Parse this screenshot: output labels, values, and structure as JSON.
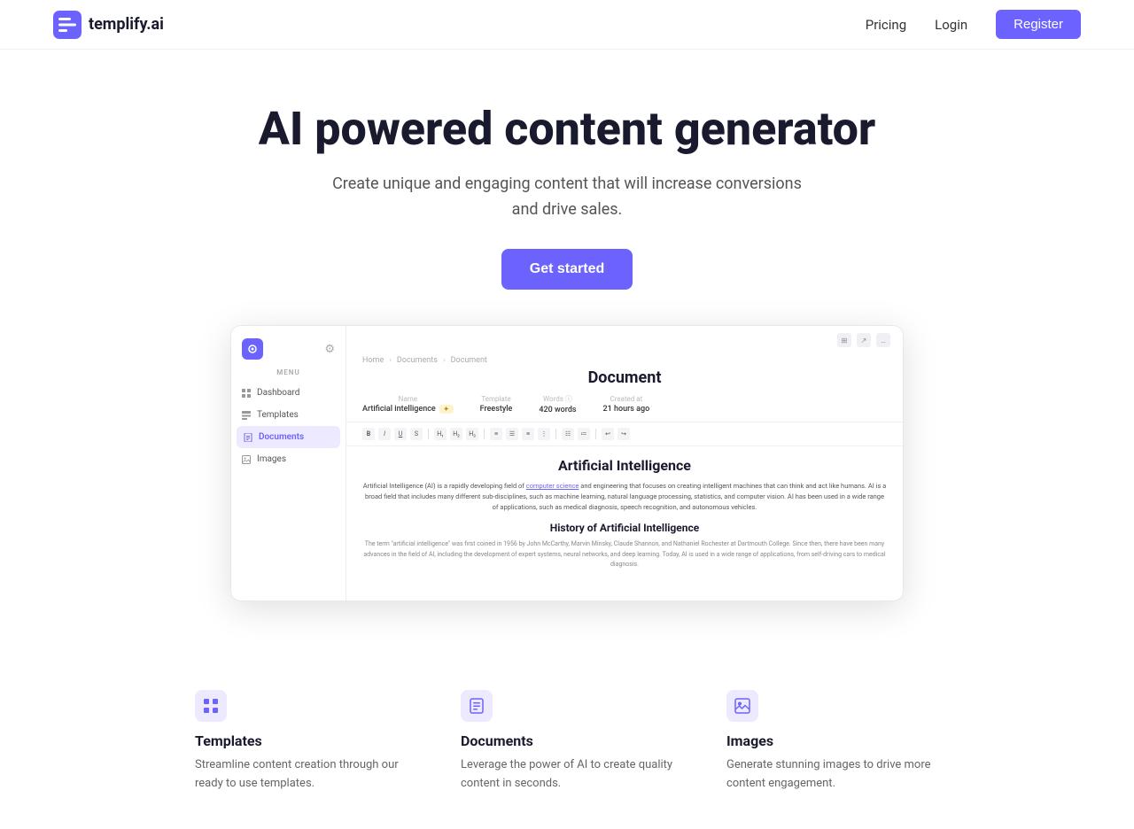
{
  "nav": {
    "logo_text": "templify.ai",
    "links": [
      {
        "label": "Pricing",
        "id": "pricing"
      },
      {
        "label": "Login",
        "id": "login"
      }
    ],
    "register_label": "Register"
  },
  "hero": {
    "title": "AI powered content generator",
    "subtitle": "Create unique and engaging content that will increase conversions and drive sales.",
    "cta_label": "Get started"
  },
  "app_screenshot": {
    "breadcrumbs": [
      "Home",
      "Documents",
      "Document"
    ],
    "doc_title": "Document",
    "meta": [
      {
        "label": "Name",
        "value": "Artificial intelligence",
        "tag": ""
      },
      {
        "label": "Template",
        "value": "Freestyle",
        "tag": "tag"
      },
      {
        "label": "Words",
        "value": "420 words"
      },
      {
        "label": "Created at",
        "value": "21 hours ago"
      }
    ],
    "sidebar": {
      "menu_label": "MENU",
      "items": [
        {
          "label": "Dashboard",
          "id": "dashboard",
          "active": false
        },
        {
          "label": "Templates",
          "id": "templates",
          "active": false
        },
        {
          "label": "Documents",
          "id": "documents",
          "active": true
        },
        {
          "label": "Images",
          "id": "images",
          "active": false
        }
      ]
    },
    "content": {
      "h1": "Artificial Intelligence",
      "body1": "Artificial Intelligence (AI) is a rapidly developing field of computer science and engineering that focuses on creating intelligent machines that can think and act like humans. AI is a broad field that includes many different sub-disciplines, such as machine learning, natural language processing, statistics, and computer vision. AI has been used in a wide range of applications, such as medical diagnosis, speech recognition, and autonomous vehicles.",
      "h2": "History of Artificial Intelligence",
      "body2": "The term \"artificial intelligence\" was first coined in 1956 by John McCarthy, Marvin Minsky, Claude Shannon, and Nathaniel Rochester at Dartmouth College. Since then, there have been many advances in the field of AI, including the development of expert systems, neural networks, and deep learning. Today, AI is used in a wide range of applications, from self-driving cars to medical diagnosis."
    }
  },
  "features": [
    {
      "id": "templates",
      "title": "Templates",
      "description": "Streamline content creation through our ready to use templates.",
      "icon": "grid"
    },
    {
      "id": "documents",
      "title": "Documents",
      "description": "Leverage the power of AI to create quality content in seconds.",
      "icon": "doc"
    },
    {
      "id": "images",
      "title": "Images",
      "description": "Generate stunning images to drive more content engagement.",
      "icon": "image"
    }
  ],
  "colors": {
    "accent": "#6c63ff",
    "accent_light": "#ede9ff"
  }
}
